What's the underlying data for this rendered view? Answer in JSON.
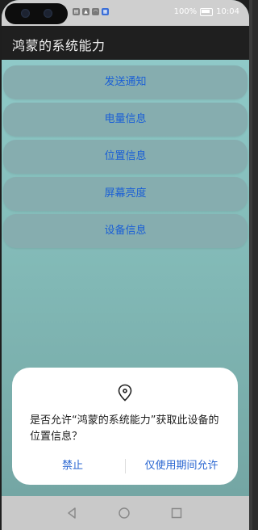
{
  "status_bar": {
    "battery_text": "100%",
    "time": "10:04",
    "left_icons": [
      "sim-icon",
      "signal-icon",
      "wifi-icon",
      "app-notification-icon"
    ]
  },
  "app": {
    "title": "鸿蒙的系统能力"
  },
  "menu": [
    {
      "label": "发送通知",
      "name": "send-notification-button"
    },
    {
      "label": "电量信息",
      "name": "battery-info-button"
    },
    {
      "label": "位置信息",
      "name": "location-info-button"
    },
    {
      "label": "屏幕亮度",
      "name": "screen-brightness-button"
    },
    {
      "label": "设备信息",
      "name": "device-info-button"
    }
  ],
  "dialog": {
    "icon": "location-pin-icon",
    "message": "是否允许“鸿蒙的系统能力”获取此设备的位置信息？",
    "deny_label": "禁止",
    "allow_label": "仅使用期间允许"
  },
  "nav_bar": {
    "icons": [
      "back-icon",
      "home-icon",
      "recents-icon"
    ]
  },
  "colors": {
    "accent": "#2a66d1",
    "menu_text": "#1a5fd6",
    "title_bar": "#1f1f1f",
    "content_bg": "#84bcb9"
  }
}
